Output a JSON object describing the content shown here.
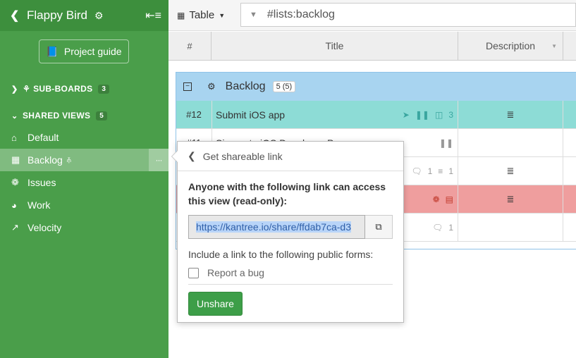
{
  "sidebar": {
    "board_title": "Flappy Bird",
    "guide_label": "Project guide",
    "subboards": {
      "label": "SUB-BOARDS",
      "count": "3"
    },
    "shared_views": {
      "label": "SHARED VIEWS",
      "count": "5"
    },
    "items": [
      {
        "label": "Default",
        "icon": "home-icon"
      },
      {
        "label": "Backlog",
        "icon": "grid-icon"
      },
      {
        "label": "Issues",
        "icon": "bug-icon"
      },
      {
        "label": "Work",
        "icon": "dashboard-icon"
      },
      {
        "label": "Velocity",
        "icon": "line-chart-icon"
      }
    ],
    "more_label": "···"
  },
  "toolbar": {
    "view_label": "Table",
    "filter_value": "#lists:backlog"
  },
  "table": {
    "headers": {
      "num": "#",
      "title": "Title",
      "description": "Description"
    }
  },
  "group": {
    "name": "Backlog",
    "count": "5 (5)",
    "toggle": "−"
  },
  "rows": [
    {
      "num": "#12",
      "title": "Submit iOS app",
      "count": "3",
      "desc_icon": "≣"
    },
    {
      "num": "#11",
      "title": "Signup to iOS Developer Program"
    },
    {
      "count_comments": "1",
      "count_checklist": "1",
      "desc_icon": "≣"
    },
    {
      "desc_icon": "≣"
    },
    {
      "count_comments": "1"
    }
  ],
  "popover": {
    "title": "Get shareable link",
    "description": "Anyone with the following link can access this view (read-only):",
    "link": "https://kantree.io/share/ffdab7ca-d3",
    "forms_label": "Include a link to the following public forms:",
    "form_option": "Report a bug",
    "unshare_label": "Unshare"
  },
  "colors": {
    "sidebar": "#4a9e4a",
    "group_header": "#a8d4f0",
    "row_cyan": "#8ddcd6",
    "row_red": "#ef9e9e",
    "unshare_button": "#3d9e48"
  }
}
